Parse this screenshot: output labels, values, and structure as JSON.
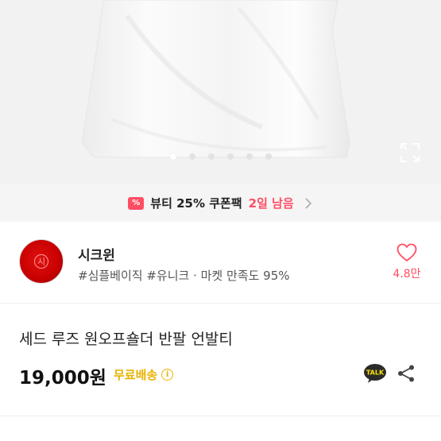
{
  "gallery": {
    "total_images": 6,
    "current_index": 1
  },
  "coupon": {
    "icon_glyph": "%",
    "text": "뷰티 25% 쿠폰팩",
    "days_left": "2일 남음",
    "accent_color": "#ff4e64"
  },
  "shop": {
    "name": "시크윈",
    "tags": "#심플베이직 #유니크 · 마켓 만족도 95%",
    "likes": "4.8만",
    "avatar_mark": "시"
  },
  "product": {
    "title": "세드 루즈 원오프숄더 반팔 언발티",
    "price": "19,000원",
    "shipping": "무료배송",
    "shipping_color": "#e8b200"
  },
  "actions": {
    "talk_label": "TALK"
  }
}
